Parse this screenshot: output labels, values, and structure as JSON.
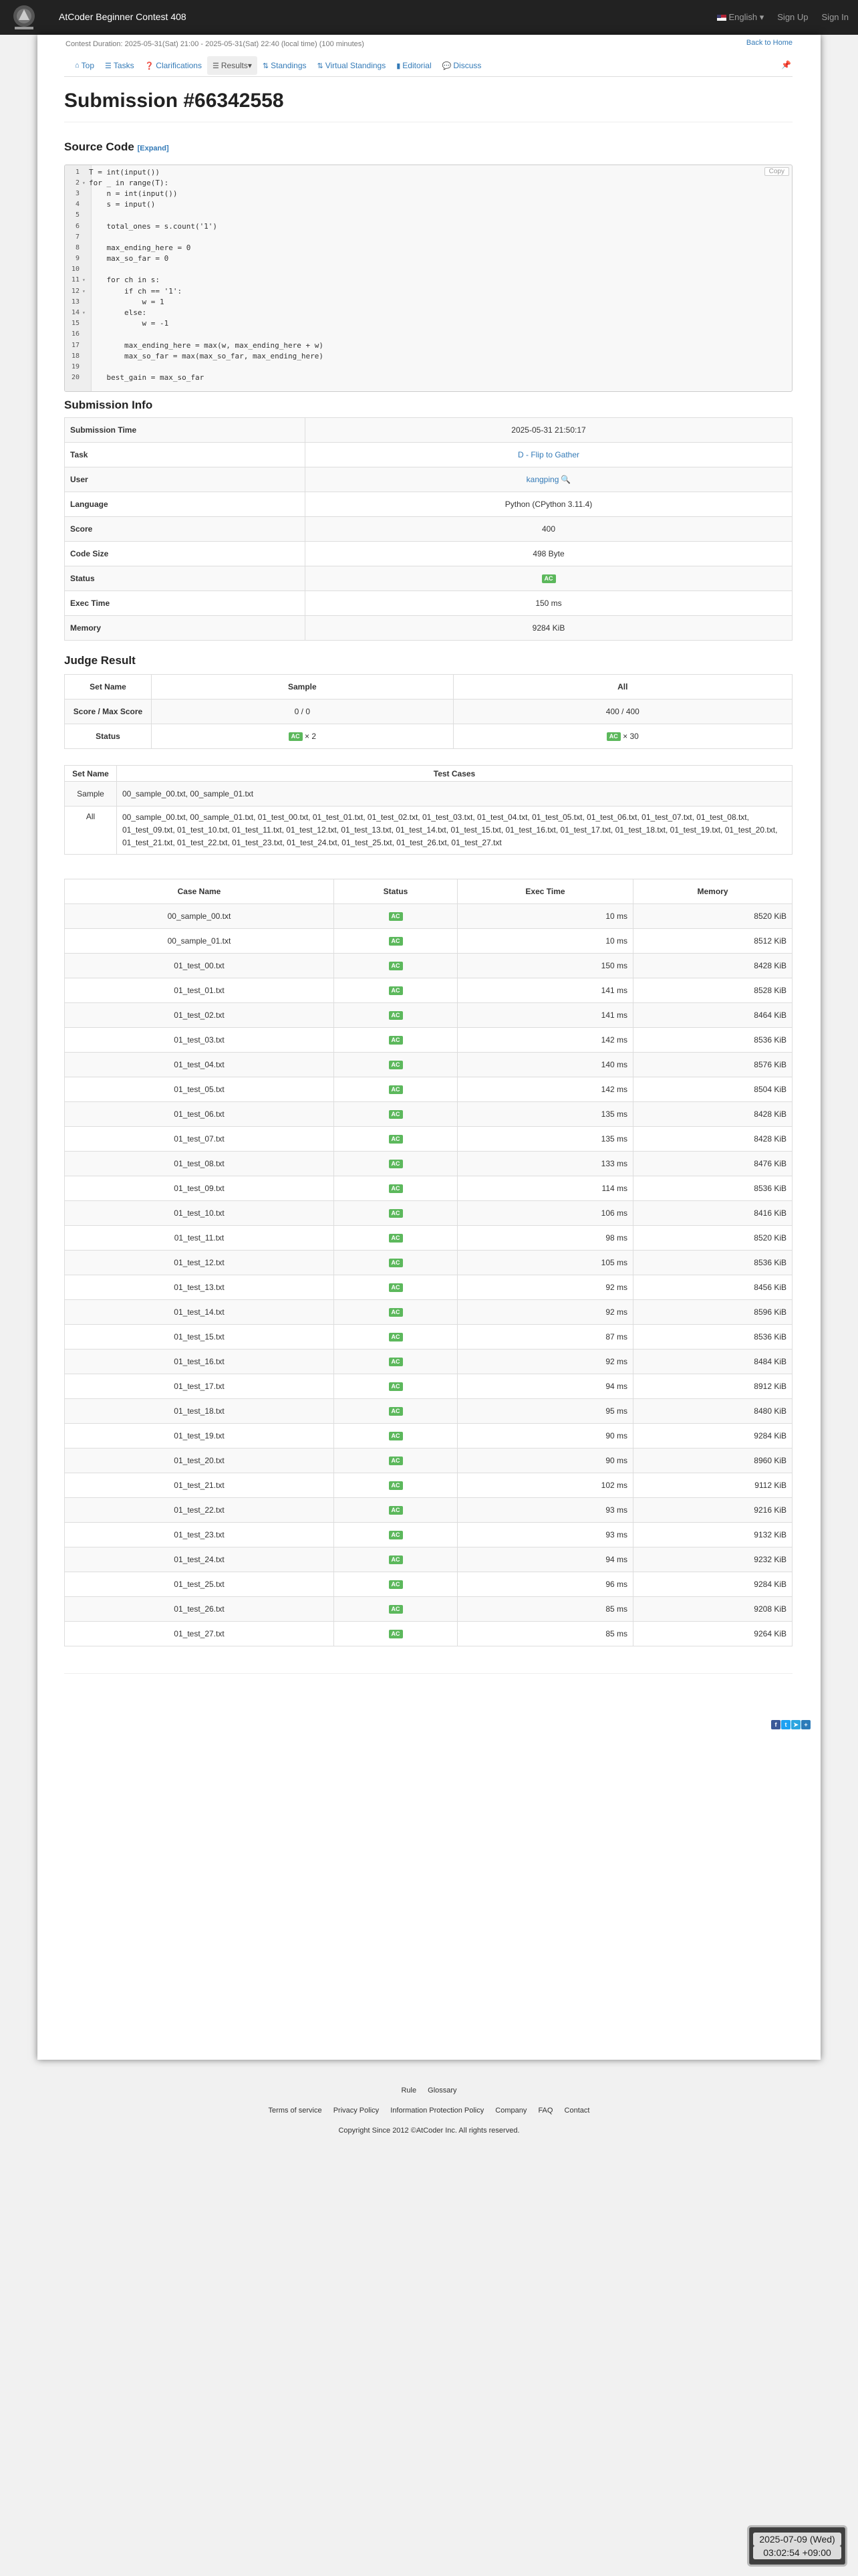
{
  "navbar": {
    "contest_title": "AtCoder Beginner Contest 408",
    "language": "English",
    "sign_up": "Sign Up",
    "sign_in": "Sign In"
  },
  "contest": {
    "duration": "Contest Duration: 2025-05-31(Sat) 21:00 - 2025-05-31(Sat) 22:40 (local time) (100 minutes)",
    "back_home": "Back to Home",
    "tabs": [
      {
        "label": "Top",
        "icon": "home-icon"
      },
      {
        "label": "Tasks",
        "icon": "list-icon"
      },
      {
        "label": "Clarifications",
        "icon": "question-icon"
      },
      {
        "label": "Results",
        "icon": "list-icon"
      },
      {
        "label": "Standings",
        "icon": "sort-icon"
      },
      {
        "label": "Virtual Standings",
        "icon": "sort-icon"
      },
      {
        "label": "Editorial",
        "icon": "book-icon"
      },
      {
        "label": "Discuss",
        "icon": "comment-icon"
      }
    ]
  },
  "submission": {
    "title": "Submission #66342558",
    "source_code_heading": "Source Code",
    "expand": "[Expand]",
    "copy": "Copy",
    "code_lines": [
      "T = int(input())",
      "for _ in range(T):",
      "    n = int(input())",
      "    s = input()",
      "",
      "    total_ones = s.count('1')",
      "",
      "    max_ending_here = 0",
      "    max_so_far = 0",
      "",
      "    for ch in s:",
      "        if ch == '1':",
      "            w = 1",
      "        else:",
      "            w = -1",
      "",
      "        max_ending_here = max(w, max_ending_here + w)",
      "        max_so_far = max(max_so_far, max_ending_here)",
      "",
      "    best_gain = max_so_far"
    ],
    "info_heading": "Submission Info",
    "info": [
      {
        "label": "Submission Time",
        "value": "2025-05-31 21:50:17"
      },
      {
        "label": "Task",
        "value": "D - Flip to Gather"
      },
      {
        "label": "User",
        "value": "kangping"
      },
      {
        "label": "Language",
        "value": "Python (CPython 3.11.4)"
      },
      {
        "label": "Score",
        "value": "400"
      },
      {
        "label": "Code Size",
        "value": "498 Byte"
      },
      {
        "label": "Status",
        "value": "AC"
      },
      {
        "label": "Exec Time",
        "value": "150 ms"
      },
      {
        "label": "Memory",
        "value": "9284 KiB"
      }
    ]
  },
  "judge": {
    "heading": "Judge Result",
    "headers": [
      "Set Name",
      "Sample",
      "All"
    ],
    "score_label": "Score / Max Score",
    "score_sample": "0 / 0",
    "score_all": "400 / 400",
    "status_label": "Status",
    "status_sample_count": "× 2",
    "status_all_count": "× 30",
    "status_badge": "AC"
  },
  "testcases": {
    "headers": [
      "Set Name",
      "Test Cases"
    ],
    "sample_name": "Sample",
    "sample_cases": "00_sample_00.txt, 00_sample_01.txt",
    "all_name": "All",
    "all_cases": "00_sample_00.txt, 00_sample_01.txt, 01_test_00.txt, 01_test_01.txt, 01_test_02.txt, 01_test_03.txt, 01_test_04.txt, 01_test_05.txt, 01_test_06.txt, 01_test_07.txt, 01_test_08.txt, 01_test_09.txt, 01_test_10.txt, 01_test_11.txt, 01_test_12.txt, 01_test_13.txt, 01_test_14.txt, 01_test_15.txt, 01_test_16.txt, 01_test_17.txt, 01_test_18.txt, 01_test_19.txt, 01_test_20.txt, 01_test_21.txt, 01_test_22.txt, 01_test_23.txt, 01_test_24.txt, 01_test_25.txt, 01_test_26.txt, 01_test_27.txt"
  },
  "cases": {
    "headers": [
      "Case Name",
      "Status",
      "Exec Time",
      "Memory"
    ],
    "rows": [
      [
        "00_sample_00.txt",
        "AC",
        "10 ms",
        "8520 KiB"
      ],
      [
        "00_sample_01.txt",
        "AC",
        "10 ms",
        "8512 KiB"
      ],
      [
        "01_test_00.txt",
        "AC",
        "150 ms",
        "8428 KiB"
      ],
      [
        "01_test_01.txt",
        "AC",
        "141 ms",
        "8528 KiB"
      ],
      [
        "01_test_02.txt",
        "AC",
        "141 ms",
        "8464 KiB"
      ],
      [
        "01_test_03.txt",
        "AC",
        "142 ms",
        "8536 KiB"
      ],
      [
        "01_test_04.txt",
        "AC",
        "140 ms",
        "8576 KiB"
      ],
      [
        "01_test_05.txt",
        "AC",
        "142 ms",
        "8504 KiB"
      ],
      [
        "01_test_06.txt",
        "AC",
        "135 ms",
        "8428 KiB"
      ],
      [
        "01_test_07.txt",
        "AC",
        "135 ms",
        "8428 KiB"
      ],
      [
        "01_test_08.txt",
        "AC",
        "133 ms",
        "8476 KiB"
      ],
      [
        "01_test_09.txt",
        "AC",
        "114 ms",
        "8536 KiB"
      ],
      [
        "01_test_10.txt",
        "AC",
        "106 ms",
        "8416 KiB"
      ],
      [
        "01_test_11.txt",
        "AC",
        "98 ms",
        "8520 KiB"
      ],
      [
        "01_test_12.txt",
        "AC",
        "105 ms",
        "8536 KiB"
      ],
      [
        "01_test_13.txt",
        "AC",
        "92 ms",
        "8456 KiB"
      ],
      [
        "01_test_14.txt",
        "AC",
        "92 ms",
        "8596 KiB"
      ],
      [
        "01_test_15.txt",
        "AC",
        "87 ms",
        "8536 KiB"
      ],
      [
        "01_test_16.txt",
        "AC",
        "92 ms",
        "8484 KiB"
      ],
      [
        "01_test_17.txt",
        "AC",
        "94 ms",
        "8912 KiB"
      ],
      [
        "01_test_18.txt",
        "AC",
        "95 ms",
        "8480 KiB"
      ],
      [
        "01_test_19.txt",
        "AC",
        "90 ms",
        "9284 KiB"
      ],
      [
        "01_test_20.txt",
        "AC",
        "90 ms",
        "8960 KiB"
      ],
      [
        "01_test_21.txt",
        "AC",
        "102 ms",
        "9112 KiB"
      ],
      [
        "01_test_22.txt",
        "AC",
        "93 ms",
        "9216 KiB"
      ],
      [
        "01_test_23.txt",
        "AC",
        "93 ms",
        "9132 KiB"
      ],
      [
        "01_test_24.txt",
        "AC",
        "94 ms",
        "9232 KiB"
      ],
      [
        "01_test_25.txt",
        "AC",
        "96 ms",
        "9284 KiB"
      ],
      [
        "01_test_26.txt",
        "AC",
        "85 ms",
        "9208 KiB"
      ],
      [
        "01_test_27.txt",
        "AC",
        "85 ms",
        "9264 KiB"
      ]
    ]
  },
  "footer": {
    "links1": [
      "Rule",
      "Glossary"
    ],
    "links2": [
      "Terms of service",
      "Privacy Policy",
      "Information Protection Policy",
      "Company",
      "FAQ",
      "Contact"
    ],
    "copyright": "Copyright Since 2012 ©AtCoder Inc. All rights reserved."
  },
  "clock": {
    "date": "2025-07-09 (Wed)",
    "time": "03:02:54 +09:00"
  },
  "colors": {
    "navbar_bg": "#222222",
    "link": "#337ab7",
    "ac_badge": "#5cb85c"
  }
}
